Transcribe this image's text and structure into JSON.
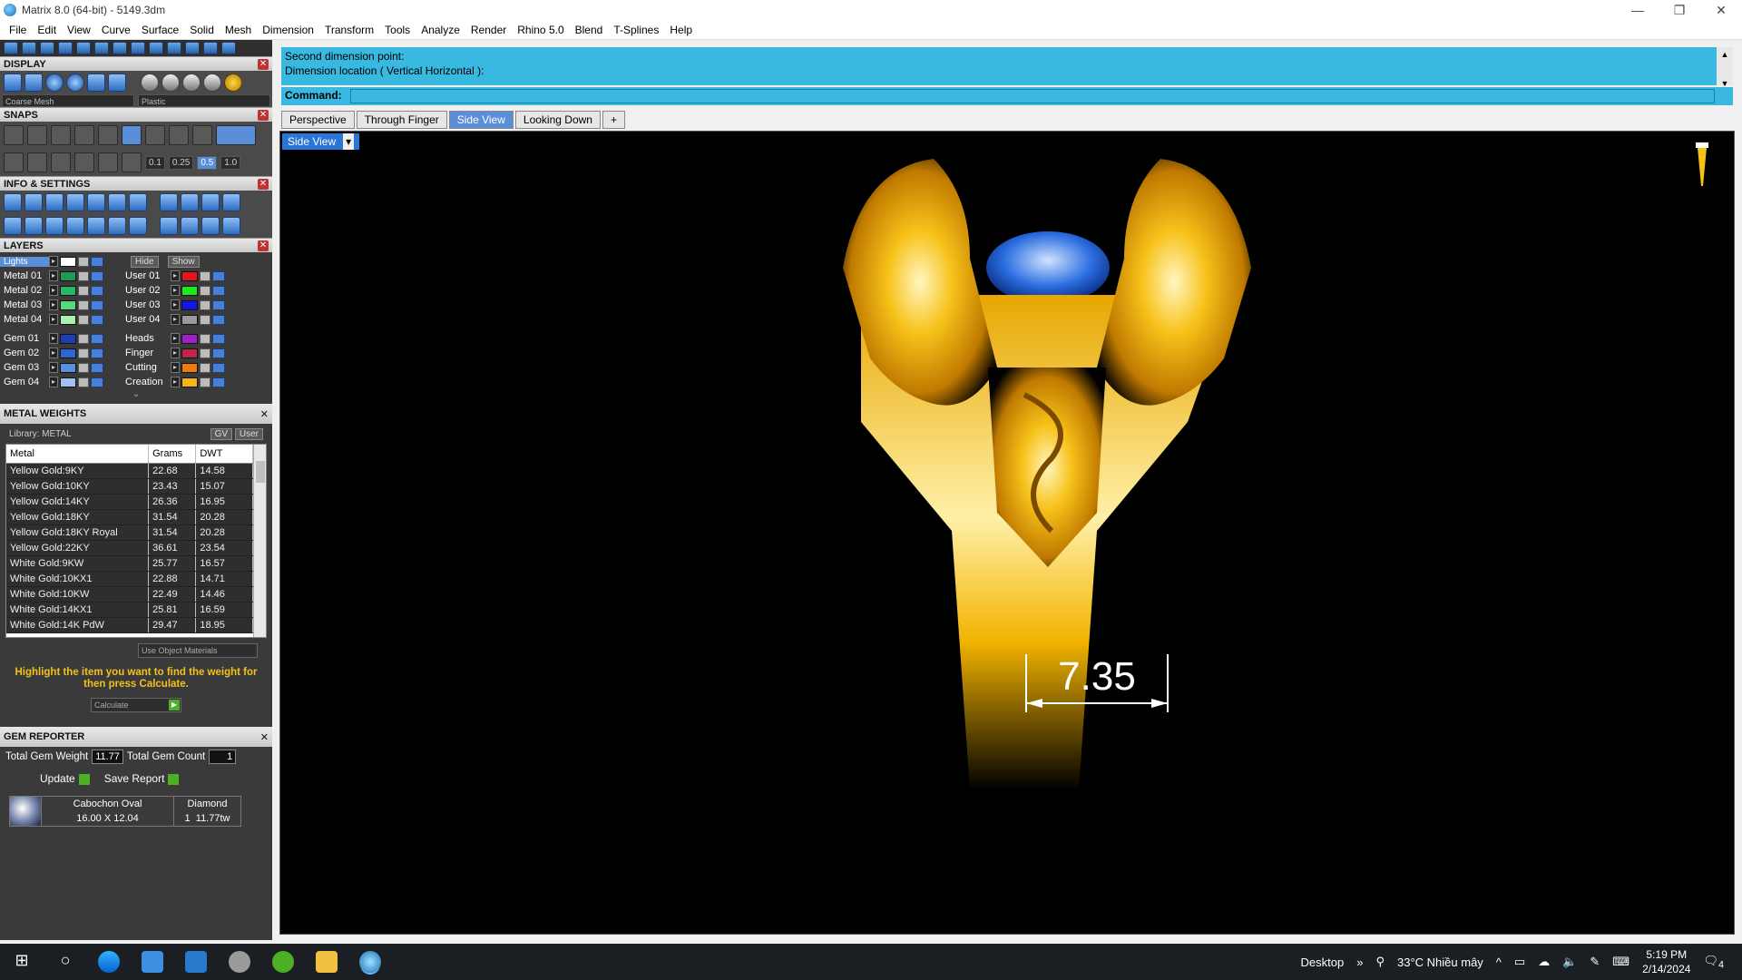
{
  "window": {
    "title": "Matrix 8.0 (64-bit) - 5149.3dm",
    "min": "—",
    "max": "❐",
    "close": "✕"
  },
  "menu": [
    "File",
    "Edit",
    "View",
    "Curve",
    "Surface",
    "Solid",
    "Mesh",
    "Dimension",
    "Transform",
    "Tools",
    "Analyze",
    "Render",
    "Rhino 5.0",
    "Blend",
    "T-Splines",
    "Help"
  ],
  "display": {
    "header": "DISPLAY",
    "mesh": "Coarse Mesh",
    "material": "Plastic"
  },
  "snaps": {
    "header": "SNAPS",
    "values": [
      "0.1",
      "0.25",
      "0.5",
      "1.0"
    ]
  },
  "info": {
    "header": "INFO & SETTINGS"
  },
  "layers": {
    "header": "LAYERS",
    "lights": "Lights",
    "hide": "Hide",
    "show": "Show",
    "left": [
      {
        "name": "Metal 01",
        "color": "#1e9a55"
      },
      {
        "name": "Metal 02",
        "color": "#27b567"
      },
      {
        "name": "Metal 03",
        "color": "#57d97b"
      },
      {
        "name": "Metal 04",
        "color": "#a8efb0"
      },
      {
        "name": "Gem 01",
        "color": "#1c3fb8"
      },
      {
        "name": "Gem 02",
        "color": "#2d66d6"
      },
      {
        "name": "Gem 03",
        "color": "#5c8fe0"
      },
      {
        "name": "Gem 04",
        "color": "#9ec2f2"
      }
    ],
    "right": [
      {
        "name": "User 01",
        "color": "#e8141c"
      },
      {
        "name": "User 02",
        "color": "#1ee81e"
      },
      {
        "name": "User 03",
        "color": "#1416e8"
      },
      {
        "name": "User 04",
        "color": "#9a9a9a"
      },
      {
        "name": "Heads",
        "color": "#a020c8"
      },
      {
        "name": "Finger",
        "color": "#c0264a"
      },
      {
        "name": "Cutting",
        "color": "#ef7b10"
      },
      {
        "name": "Creation",
        "color": "#f5b41b"
      }
    ]
  },
  "metal_weights": {
    "header": "METAL WEIGHTS",
    "library": "Library: METAL",
    "gv": "GV",
    "user": "User",
    "columns": [
      "Metal",
      "Grams",
      "DWT"
    ],
    "rows": [
      [
        "Yellow Gold:9KY",
        "22.68",
        "14.58"
      ],
      [
        "Yellow Gold:10KY",
        "23.43",
        "15.07"
      ],
      [
        "Yellow Gold:14KY",
        "26.36",
        "16.95"
      ],
      [
        "Yellow Gold:18KY",
        "31.54",
        "20.28"
      ],
      [
        "Yellow Gold:18KY Royal",
        "31.54",
        "20.28"
      ],
      [
        "Yellow Gold:22KY",
        "36.61",
        "23.54"
      ],
      [
        "White Gold:9KW",
        "25.77",
        "16.57"
      ],
      [
        "White Gold:10KX1",
        "22.88",
        "14.71"
      ],
      [
        "White Gold:10KW",
        "22.49",
        "14.46"
      ],
      [
        "White Gold:14KX1",
        "25.81",
        "16.59"
      ],
      [
        "White Gold:14K PdW",
        "29.47",
        "18.95"
      ]
    ],
    "use_object_materials": "Use Object Materials",
    "hint": "Highlight the item you want to find the weight for then press Calculate.",
    "calculate": "Calculate"
  },
  "gem_reporter": {
    "header": "GEM REPORTER",
    "total_weight_label": "Total Gem Weight",
    "total_weight": "11.77",
    "total_count_label": "Total Gem Count",
    "total_count": "1",
    "update": "Update",
    "save_report": "Save Report",
    "gem": {
      "shape": "Cabochon Oval",
      "material": "Diamond",
      "size": "16.00 X 12.04",
      "qty": "1",
      "weight": "11.77tw"
    }
  },
  "command": {
    "history": [
      "Second dimension point:",
      "Dimension location ( Vertical  Horizontal ):"
    ],
    "prompt": "Command:"
  },
  "viewport_tabs": [
    "Perspective",
    "Through Finger",
    "Side View",
    "Looking Down",
    "+"
  ],
  "active_tab": "Side View",
  "viewport": {
    "label": "Side View",
    "dimension": "7.35"
  },
  "taskbar": {
    "desktop": "Desktop",
    "weather": "33°C  Nhiều mây",
    "time": "5:19 PM",
    "date": "2/14/2024",
    "notifications": "4"
  }
}
